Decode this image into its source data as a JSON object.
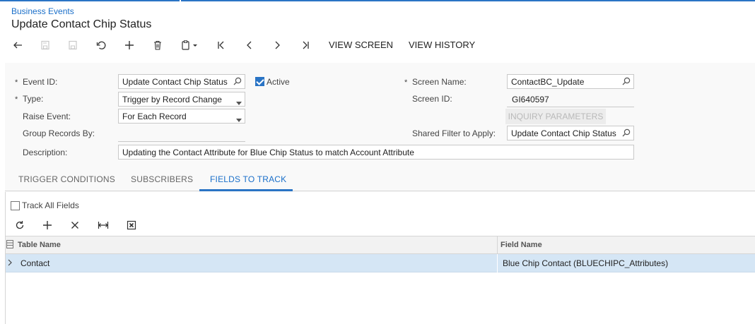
{
  "breadcrumb": "Business Events",
  "title": "Update Contact Chip Status",
  "toolbar": {
    "icons": [
      "back-icon",
      "save-close-icon",
      "save-icon",
      "undo-icon",
      "add-icon",
      "delete-icon",
      "clipboard-icon",
      "first-icon",
      "prev-icon",
      "next-icon",
      "last-icon"
    ],
    "view_screen": "VIEW SCREEN",
    "view_history": "VIEW HISTORY"
  },
  "form": {
    "event_id": {
      "label": "Event ID:",
      "value": "Update Contact Chip Status",
      "required": true
    },
    "active": {
      "label": "Active",
      "checked": true
    },
    "type": {
      "label": "Type:",
      "value": "Trigger by Record Change",
      "required": true
    },
    "raise_event": {
      "label": "Raise Event:",
      "value": "For Each Record"
    },
    "group_records_by": {
      "label": "Group Records By:",
      "value": ""
    },
    "description": {
      "label": "Description:",
      "value": "Updating the Contact Attribute for Blue Chip Status to match Account Attribute"
    },
    "screen_name": {
      "label": "Screen Name:",
      "value": "ContactBC_Update",
      "required": true
    },
    "screen_id": {
      "label": "Screen ID:",
      "value": "GI640597"
    },
    "inquiry_parameters": "INQUIRY PARAMETERS",
    "shared_filter": {
      "label": "Shared Filter to Apply:",
      "value": "Update Contact Chip Status"
    },
    "required_marker": "*"
  },
  "tabs": [
    "TRIGGER CONDITIONS",
    "SUBSCRIBERS",
    "FIELDS TO TRACK"
  ],
  "active_tab": "FIELDS TO TRACK",
  "track_all_fields": {
    "label": "Track All Fields",
    "checked": false
  },
  "grid": {
    "toolbar_icons": [
      "refresh-icon",
      "add-row-icon",
      "delete-row-icon",
      "fit-columns-icon",
      "export-excel-icon"
    ],
    "columns": [
      "Table Name",
      "Field Name"
    ],
    "rows": [
      {
        "table_name": "Contact",
        "field_name": "Blue Chip Contact (BLUECHIPC_Attributes)"
      }
    ]
  },
  "colors": {
    "accent": "#2a74c5",
    "link": "#1a6fc9",
    "row_selected": "#d5e6f5",
    "checkbox_active": "#2a74c5"
  }
}
